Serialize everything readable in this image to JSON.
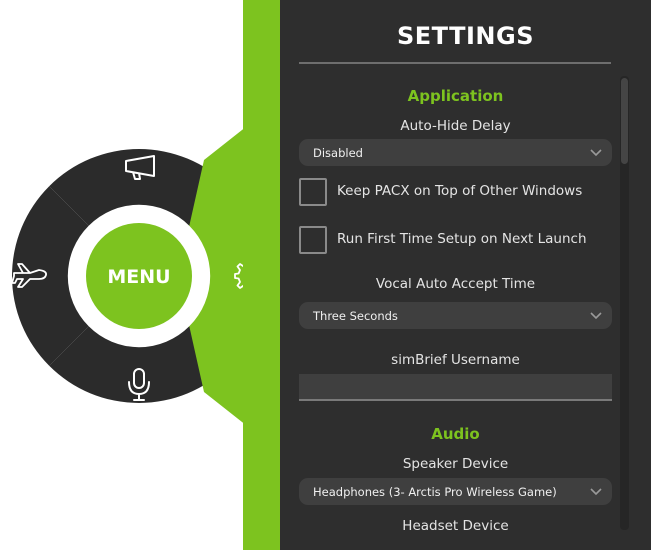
{
  "menu": {
    "center_label": "MENU",
    "segments": [
      {
        "name": "announcement",
        "icon": "megaphone-icon"
      },
      {
        "name": "flight",
        "icon": "airplane-icon"
      },
      {
        "name": "voice",
        "icon": "microphone-icon"
      },
      {
        "name": "settings",
        "icon": "gear-icon",
        "active": true
      }
    ]
  },
  "settings": {
    "title": "SETTINGS",
    "application": {
      "heading": "Application",
      "auto_hide_label": "Auto-Hide Delay",
      "auto_hide_value": "Disabled",
      "keep_on_top_label": "Keep PACX on Top of Other Windows",
      "keep_on_top_checked": false,
      "first_setup_label": "Run First Time Setup on Next Launch",
      "first_setup_checked": false,
      "vocal_accept_label": "Vocal Auto Accept Time",
      "vocal_accept_value": "Three Seconds",
      "simbrief_label": "simBrief Username",
      "simbrief_value": ""
    },
    "audio": {
      "heading": "Audio",
      "speaker_label": "Speaker Device",
      "speaker_value": "Headphones (3- Arctis Pro Wireless Game)",
      "headset_label": "Headset Device"
    }
  },
  "colors": {
    "accent": "#7dc31f",
    "panel": "#2e2e2e",
    "segment": "#2b2b2b"
  }
}
